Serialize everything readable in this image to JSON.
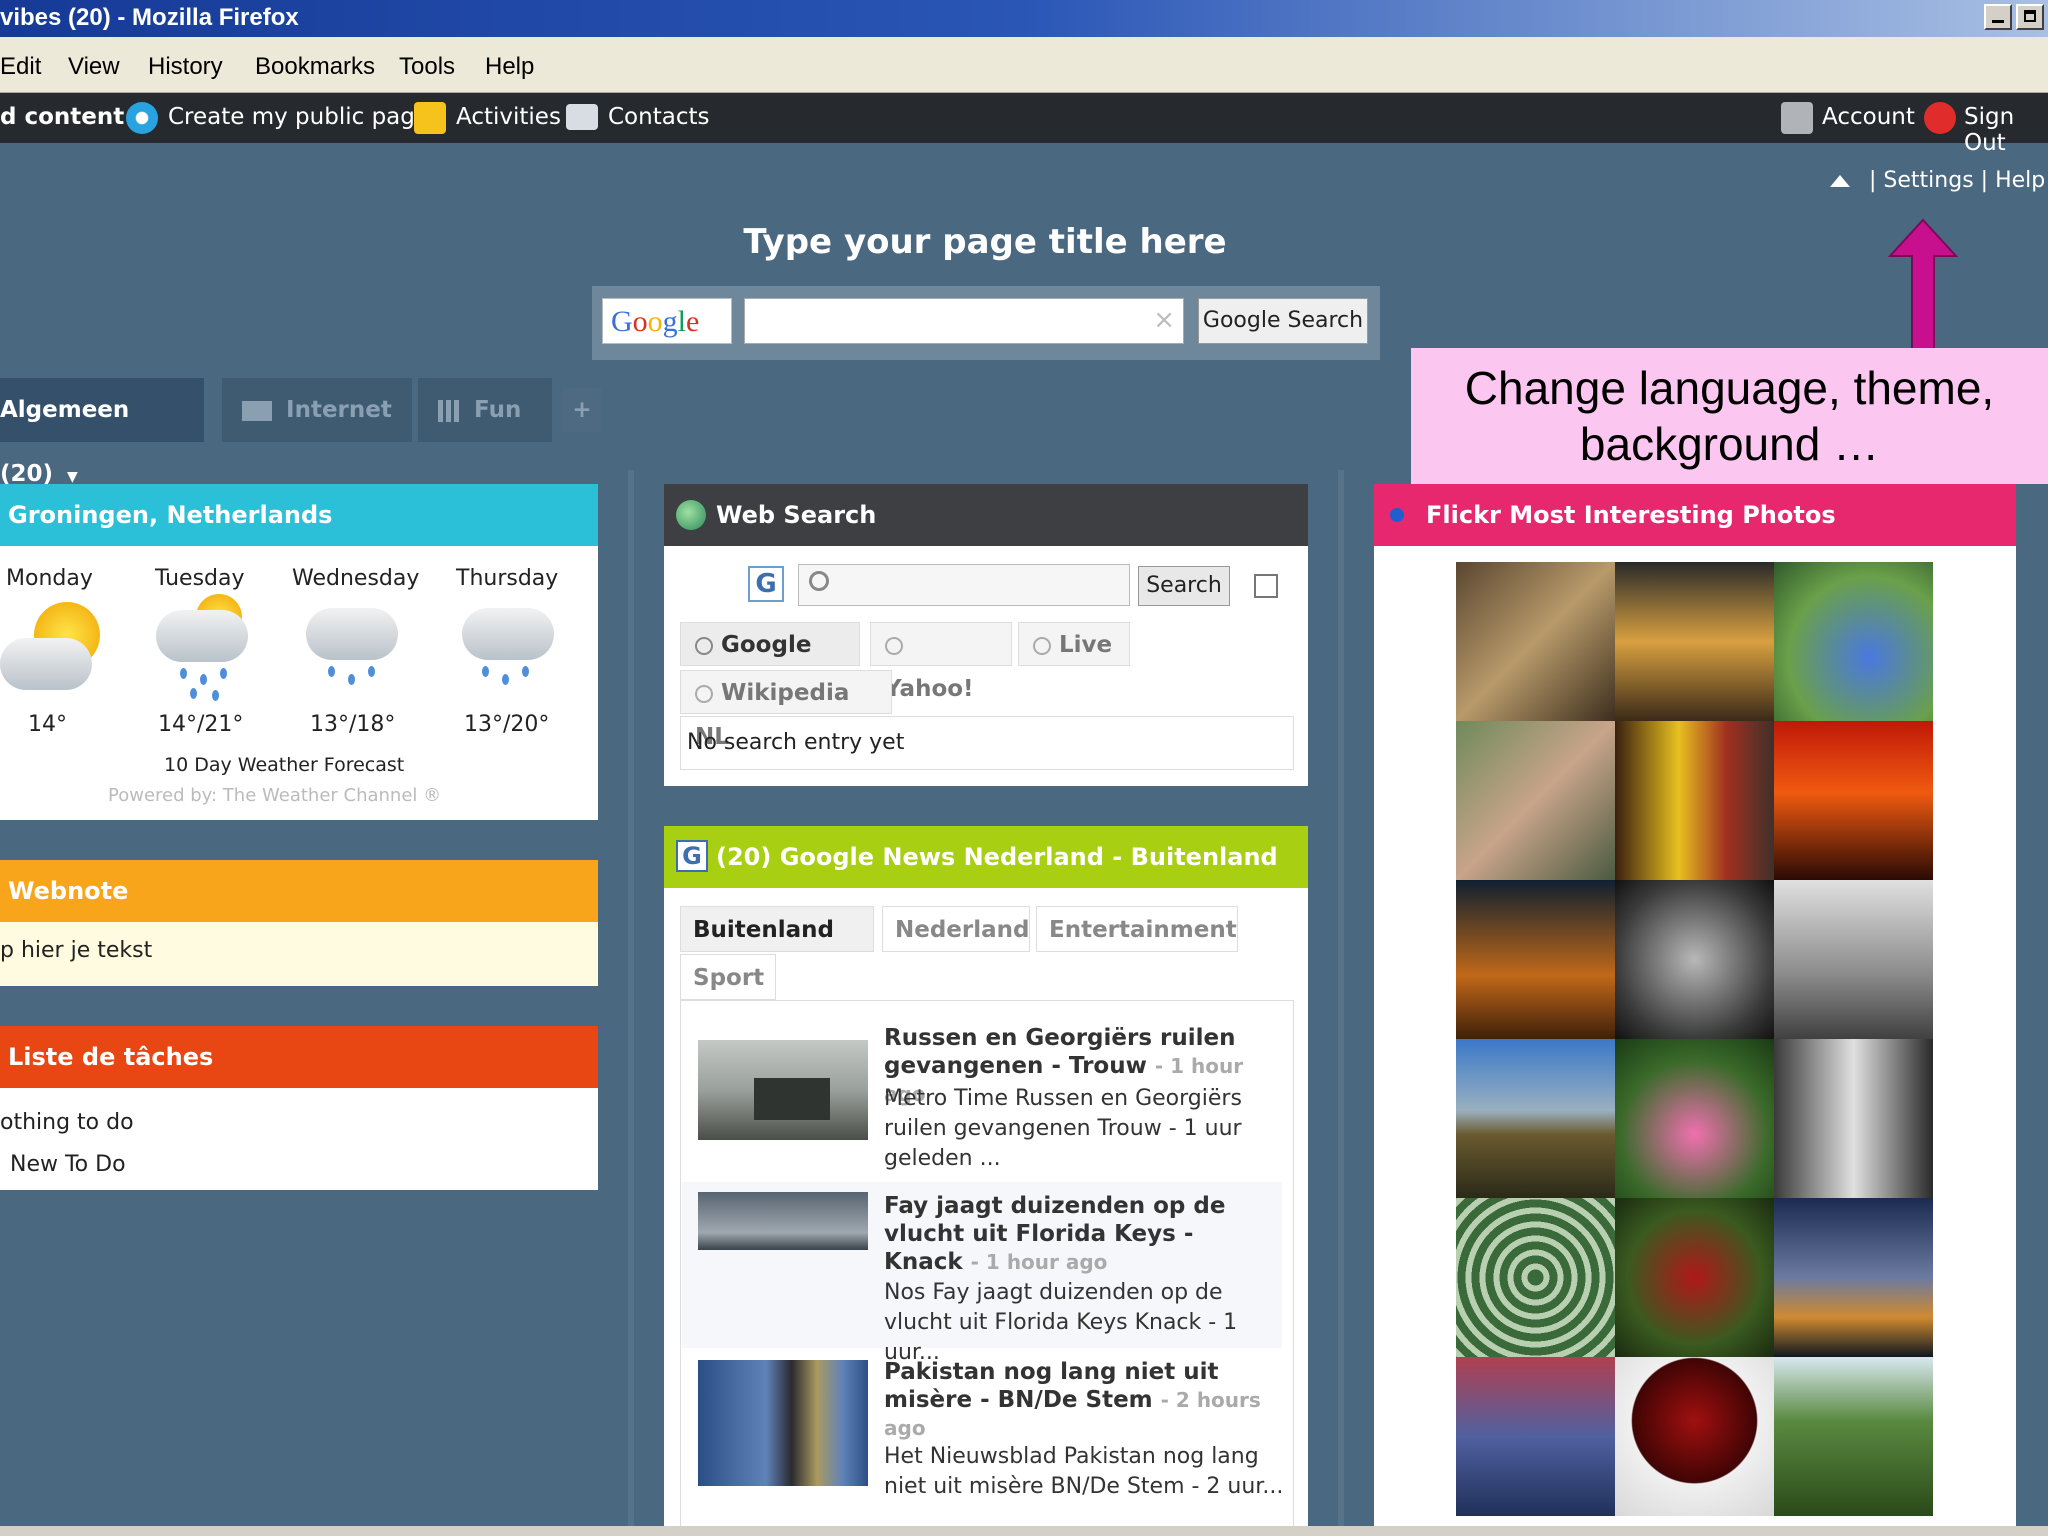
{
  "window": {
    "title": "vibes (20) - Mozilla Firefox"
  },
  "menu": [
    "Edit",
    "View",
    "History",
    "Bookmarks",
    "Tools",
    "Help"
  ],
  "topbar": {
    "add_content": "d content",
    "public_page": "Create my public page",
    "activities": "Activities",
    "contacts": "Contacts",
    "account": "Account",
    "sign_out": "Sign Out"
  },
  "links": {
    "settings": "Settings",
    "help": "Help",
    "sep": "|"
  },
  "page_title": "Type your page title here",
  "google_search": {
    "logo": "Google",
    "button": "Google Search",
    "clear": "×"
  },
  "tabs": [
    {
      "label": "Algemeen (20)"
    },
    {
      "label": "Internet"
    },
    {
      "label": "Fun"
    },
    {
      "label": "+"
    }
  ],
  "annotation": "Change language, theme, background …",
  "weather": {
    "title": "Groningen, Netherlands",
    "days": [
      {
        "day": "Monday",
        "temp": "14°"
      },
      {
        "day": "Tuesday",
        "temp": "14°/21°"
      },
      {
        "day": "Wednesday",
        "temp": "13°/18°"
      },
      {
        "day": "Thursday",
        "temp": "13°/20°"
      }
    ],
    "forecast_link": "10 Day Weather Forecast",
    "powered": "Powered by: The Weather Channel ®"
  },
  "webnote": {
    "title": "Webnote",
    "text": "p hier je tekst"
  },
  "tasks": {
    "title": "Liste de tâches",
    "empty": "othing to do",
    "new": "New To Do"
  },
  "websearch": {
    "title": "Web Search",
    "button": "Search",
    "engines": [
      "Google",
      "Yahoo!",
      "Live",
      "Wikipedia NL"
    ],
    "empty": "No search entry yet"
  },
  "news": {
    "title": "(20) Google News Nederland - Buitenland",
    "tabs": [
      "Buitenland",
      "Nederland",
      "Entertainment",
      "Sport"
    ],
    "items": [
      {
        "title": "Russen en Georgiërs ruilen gevangenen - Trouw",
        "age": "- 1 hour ago",
        "snippet": "Metro Time Russen en Georgiërs ruilen gevangenen Trouw - 1 uur geleden ..."
      },
      {
        "title": "Fay jaagt duizenden op de vlucht uit Florida Keys - Knack",
        "age": "- 1 hour ago",
        "snippet": "Nos Fay jaagt duizenden op de vlucht uit Florida Keys Knack - 1 uur..."
      },
      {
        "title": "Pakistan nog lang niet uit misère - BN/De Stem",
        "age": "- 2 hours ago",
        "snippet": "Het Nieuwsblad Pakistan nog lang niet uit misère BN/De Stem - 2 uur..."
      }
    ]
  },
  "flickr": {
    "title": "Flickr Most Interesting Photos"
  }
}
